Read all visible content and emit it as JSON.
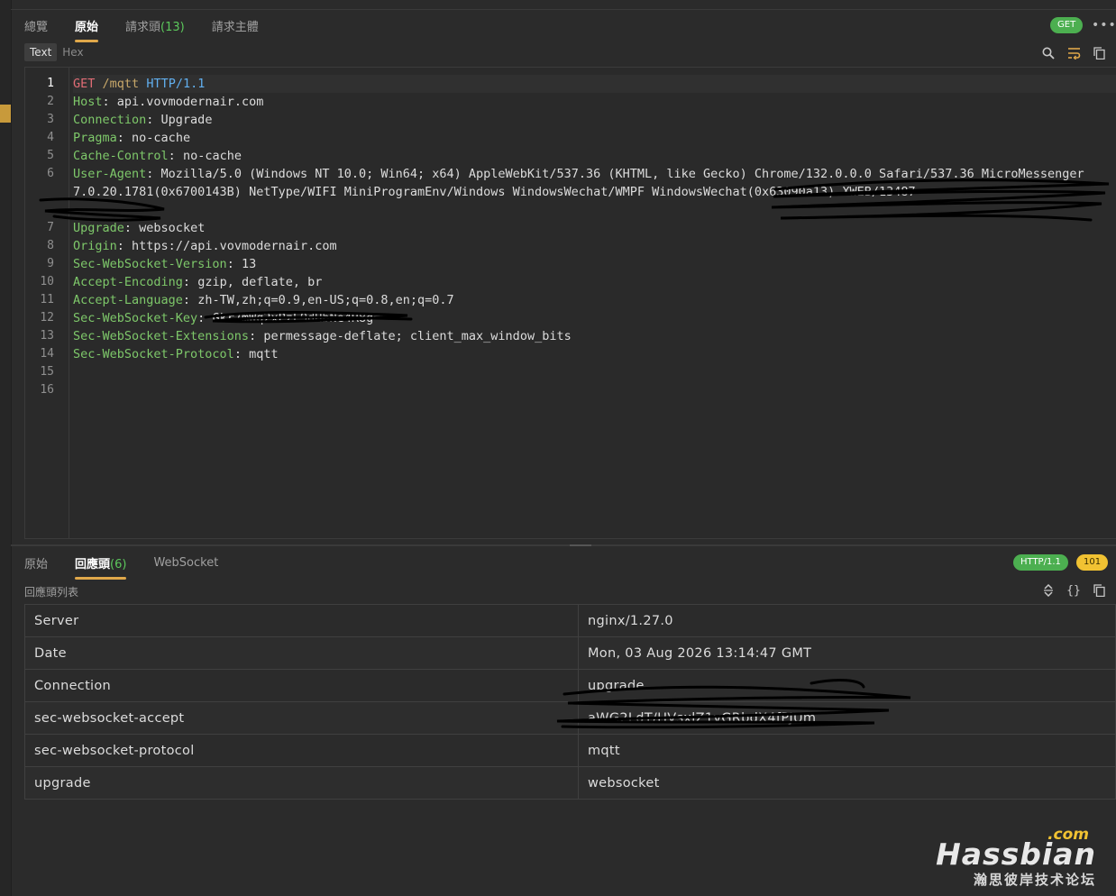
{
  "request_tabs": [
    {
      "label": "總覽",
      "count": ""
    },
    {
      "label": "原始",
      "count": ""
    },
    {
      "label": "請求頭",
      "count": "(13)"
    },
    {
      "label": "請求主體",
      "count": ""
    }
  ],
  "request_method_badge": "GET",
  "more_label": "•••",
  "view_modes": [
    "Text",
    "Hex"
  ],
  "raw_request": {
    "line_numbers": [
      "1",
      "2",
      "3",
      "4",
      "5",
      "6",
      "7",
      "8",
      "9",
      "10",
      "11",
      "12",
      "13",
      "14",
      "15",
      "16"
    ],
    "request_line": {
      "method": "GET",
      "path": "/mqtt",
      "version": "HTTP/1.1"
    },
    "headers": [
      {
        "name": "Host",
        "value": "api.vovmodernair.com"
      },
      {
        "name": "Connection",
        "value": "Upgrade"
      },
      {
        "name": "Pragma",
        "value": "no-cache"
      },
      {
        "name": "Cache-Control",
        "value": "no-cache"
      },
      {
        "name": "User-Agent",
        "value": "Mozilla/5.0 (Windows NT 10.0; Win64; x64) AppleWebKit/537.36 (KHTML, like Gecko) Chrome/132.0.0.0 Safari/537.36 MicroMessenger"
      },
      {
        "name": "",
        "value": "7.0.20.1781(0x6700143B) NetType/WIFI MiniProgramEnv/Windows WindowsWechat/WMPF WindowsWechat(0x63090a13) XWEB/13487"
      },
      {
        "name": "Upgrade",
        "value": "websocket"
      },
      {
        "name": "Origin",
        "value": "https://api.vovmodernair.com"
      },
      {
        "name": "Sec-WebSocket-Version",
        "value": "13"
      },
      {
        "name": "Accept-Encoding",
        "value": "gzip, deflate, br"
      },
      {
        "name": "Accept-Language",
        "value": "zh-TW,zh;q=0.9,en-US;q=0.8,en;q=0.7"
      },
      {
        "name": "Sec-WebSocket-Key",
        "value": "Gkr7mWq2xPzL9dHbNe4R8g=="
      },
      {
        "name": "Sec-WebSocket-Extensions",
        "value": "permessage-deflate; client_max_window_bits"
      },
      {
        "name": "Sec-WebSocket-Protocol",
        "value": "mqtt"
      }
    ]
  },
  "response_tabs": [
    {
      "label": "原始",
      "count": ""
    },
    {
      "label": "回應頭",
      "count": "(6)"
    },
    {
      "label": "WebSocket",
      "count": ""
    }
  ],
  "response_protocol_badge": "HTTP/1.1",
  "response_status_badge": "101",
  "response_list_label": "回應頭列表",
  "response_headers": [
    {
      "name": "Server",
      "value": "nginx/1.27.0"
    },
    {
      "name": "Date",
      "value": "Mon, 03 Aug 2026 13:14:47 GMT"
    },
    {
      "name": "Connection",
      "value": "upgrade"
    },
    {
      "name": "sec-websocket-accept",
      "value": "aWG2LdT/HVsxlZ1vGRbdX4fPJUm"
    },
    {
      "name": "sec-websocket-protocol",
      "value": "mqtt"
    },
    {
      "name": "upgrade",
      "value": "websocket"
    }
  ],
  "watermark": {
    "com": ".com",
    "brand": "Hassbian",
    "sub": "瀚思彼岸技术论坛"
  },
  "icons": {
    "request_toolbar": [
      "search-icon",
      "wrap-icon",
      "copy-icon"
    ],
    "response_toolbar": [
      "sort-icon",
      "braces-icon",
      "copy-icon"
    ]
  },
  "colors": {
    "accent": "#e0a84a",
    "header_name": "#7ec86a",
    "method": "#e06c75",
    "badge_green": "#4caf50",
    "badge_yellow": "#f1c232"
  }
}
